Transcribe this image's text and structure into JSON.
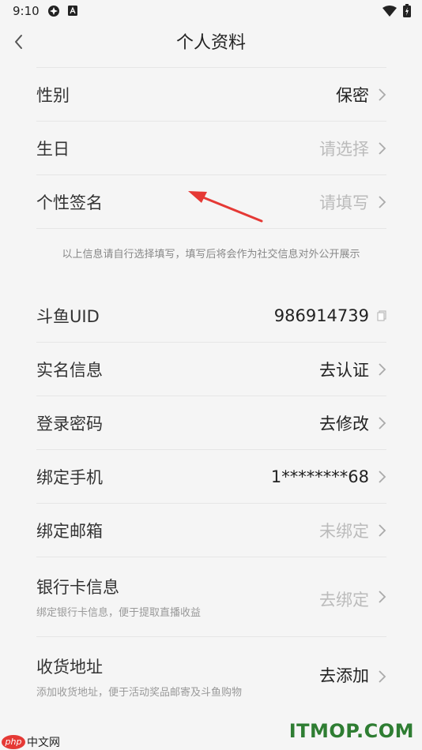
{
  "status_bar": {
    "time": "9:10"
  },
  "header": {
    "title": "个人资料"
  },
  "profile": [
    {
      "label": "性别",
      "value": "保密",
      "placeholder": false
    },
    {
      "label": "生日",
      "value": "请选择",
      "placeholder": true
    },
    {
      "label": "个性签名",
      "value": "请填写",
      "placeholder": true
    }
  ],
  "notice": "以上信息请自行选择填写，填写后将会作为社交信息对外公开展示",
  "account": {
    "uid_label": "斗鱼UID",
    "uid_value": "986914739",
    "realname_label": "实名信息",
    "realname_value": "去认证",
    "password_label": "登录密码",
    "password_value": "去修改",
    "phone_label": "绑定手机",
    "phone_value": "1********68",
    "email_label": "绑定邮箱",
    "email_value": "未绑定",
    "bank_label": "银行卡信息",
    "bank_sub": "绑定银行卡信息，便于提取直播收益",
    "bank_value": "去绑定",
    "address_label": "收货地址",
    "address_sub": "添加收货地址，便于活动奖品邮寄及斗鱼购物",
    "address_value": "去添加"
  },
  "watermarks": {
    "php": "php",
    "cn": "中文网",
    "itmop": "ITMOP.COM"
  },
  "colors": {
    "background": "#f5f5f5",
    "placeholder": "#bbbbbb",
    "annotation_arrow": "#e53935",
    "watermark_green": "#2e7d32"
  }
}
